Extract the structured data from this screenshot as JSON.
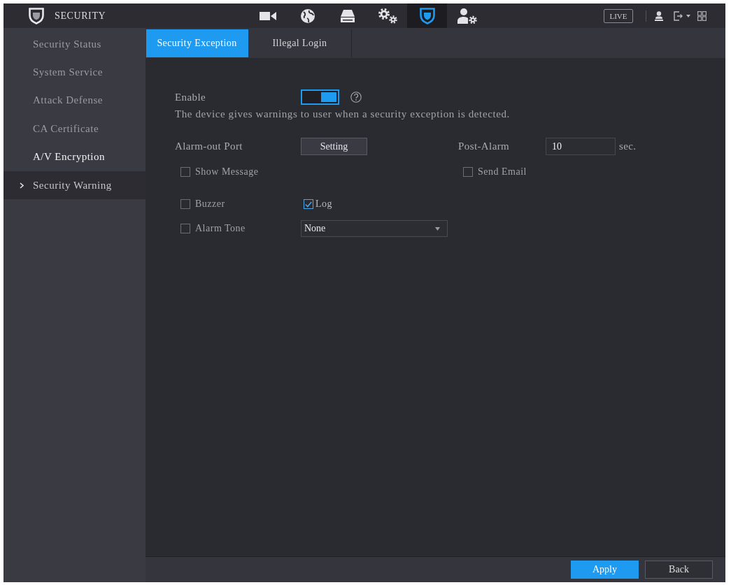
{
  "header": {
    "title": "SECURITY",
    "nav": [
      {
        "kind": "camera",
        "selected": false
      },
      {
        "kind": "network",
        "selected": false
      },
      {
        "kind": "storage",
        "selected": false
      },
      {
        "kind": "system",
        "selected": false
      },
      {
        "kind": "security",
        "selected": true
      },
      {
        "kind": "account",
        "selected": false
      }
    ],
    "live_button": "LIVE"
  },
  "sidebar": {
    "items": [
      {
        "label": "Security Status",
        "selected": false,
        "hovered": false
      },
      {
        "label": "System Service",
        "selected": false,
        "hovered": false
      },
      {
        "label": "Attack Defense",
        "selected": false,
        "hovered": false
      },
      {
        "label": "CA Certificate",
        "selected": false,
        "hovered": false
      },
      {
        "label": "A/V Encryption",
        "selected": false,
        "hovered": true
      },
      {
        "label": "Security Warning",
        "selected": true,
        "hovered": false
      }
    ]
  },
  "tabs": [
    {
      "label": "Security Exception",
      "selected": true
    },
    {
      "label": "Illegal Login",
      "selected": false
    }
  ],
  "form": {
    "enable": {
      "label": "Enable",
      "on": true
    },
    "description": "The device gives warnings to user when a security exception is detected.",
    "alarm_out": {
      "label": "Alarm-out Port",
      "button": "Setting"
    },
    "post_alarm": {
      "label": "Post-Alarm",
      "value": "10",
      "unit": "sec."
    },
    "show_message": {
      "label": "Show Message",
      "checked": false
    },
    "send_email": {
      "label": "Send Email",
      "checked": false
    },
    "buzzer": {
      "label": "Buzzer",
      "checked": false
    },
    "log": {
      "label": "Log",
      "checked": true
    },
    "alarm_tone": {
      "label": "Alarm Tone",
      "checked": false,
      "value": "None"
    }
  },
  "footer": {
    "buttons": [
      {
        "label": "Apply",
        "kind": "primary"
      },
      {
        "label": "Back",
        "kind": "secondary"
      }
    ]
  }
}
